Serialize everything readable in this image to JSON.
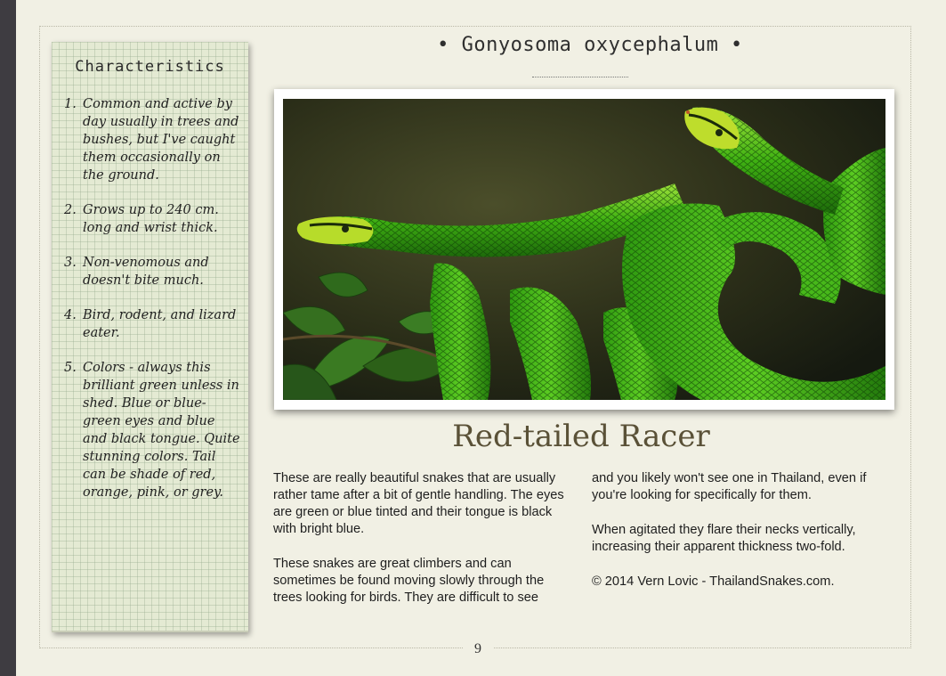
{
  "sidebar": {
    "title": "Characteristics",
    "items": [
      {
        "num": "1.",
        "text": "Common and active by day usually in trees and bushes, but I've caught them occasionally on the ground."
      },
      {
        "num": "2.",
        "text": "Grows up to 240 cm. long and wrist thick."
      },
      {
        "num": "3.",
        "text": "Non-venomous and doesn't bite much."
      },
      {
        "num": "4.",
        "text": "Bird, rodent, and lizard eater."
      },
      {
        "num": "5.",
        "text": "Colors - always this brilliant green unless in shed. Blue or blue-green eyes and blue and black tongue. Quite stunning colors. Tail can be shade of red, orange, pink, or grey."
      }
    ]
  },
  "header": {
    "species": "• Gonyosoma oxycephalum •"
  },
  "article": {
    "title": "Red-tailed Racer",
    "left_paragraphs": [
      "These are really beautiful snakes that are usually rather tame after a bit of gentle handling. The eyes are green or blue tinted and their tongue is black with bright blue.",
      "These snakes are great climbers and can sometimes be found moving slowly through the trees looking for birds. They are difficult to see"
    ],
    "right_paragraphs": [
      "and you likely won't see one in Thailand, even if you're looking for specifically for them.",
      "When agitated they flare their necks vertically, increasing their apparent thickness two-fold.",
      "© 2014 Vern Lovic - ThailandSnakes.com."
    ]
  },
  "footer": {
    "page_number": "9"
  },
  "colors": {
    "page": "#f1f0e4",
    "notepad": "#e4ead3",
    "title": "#5a5137",
    "snake_green": "#4fbf1c"
  }
}
